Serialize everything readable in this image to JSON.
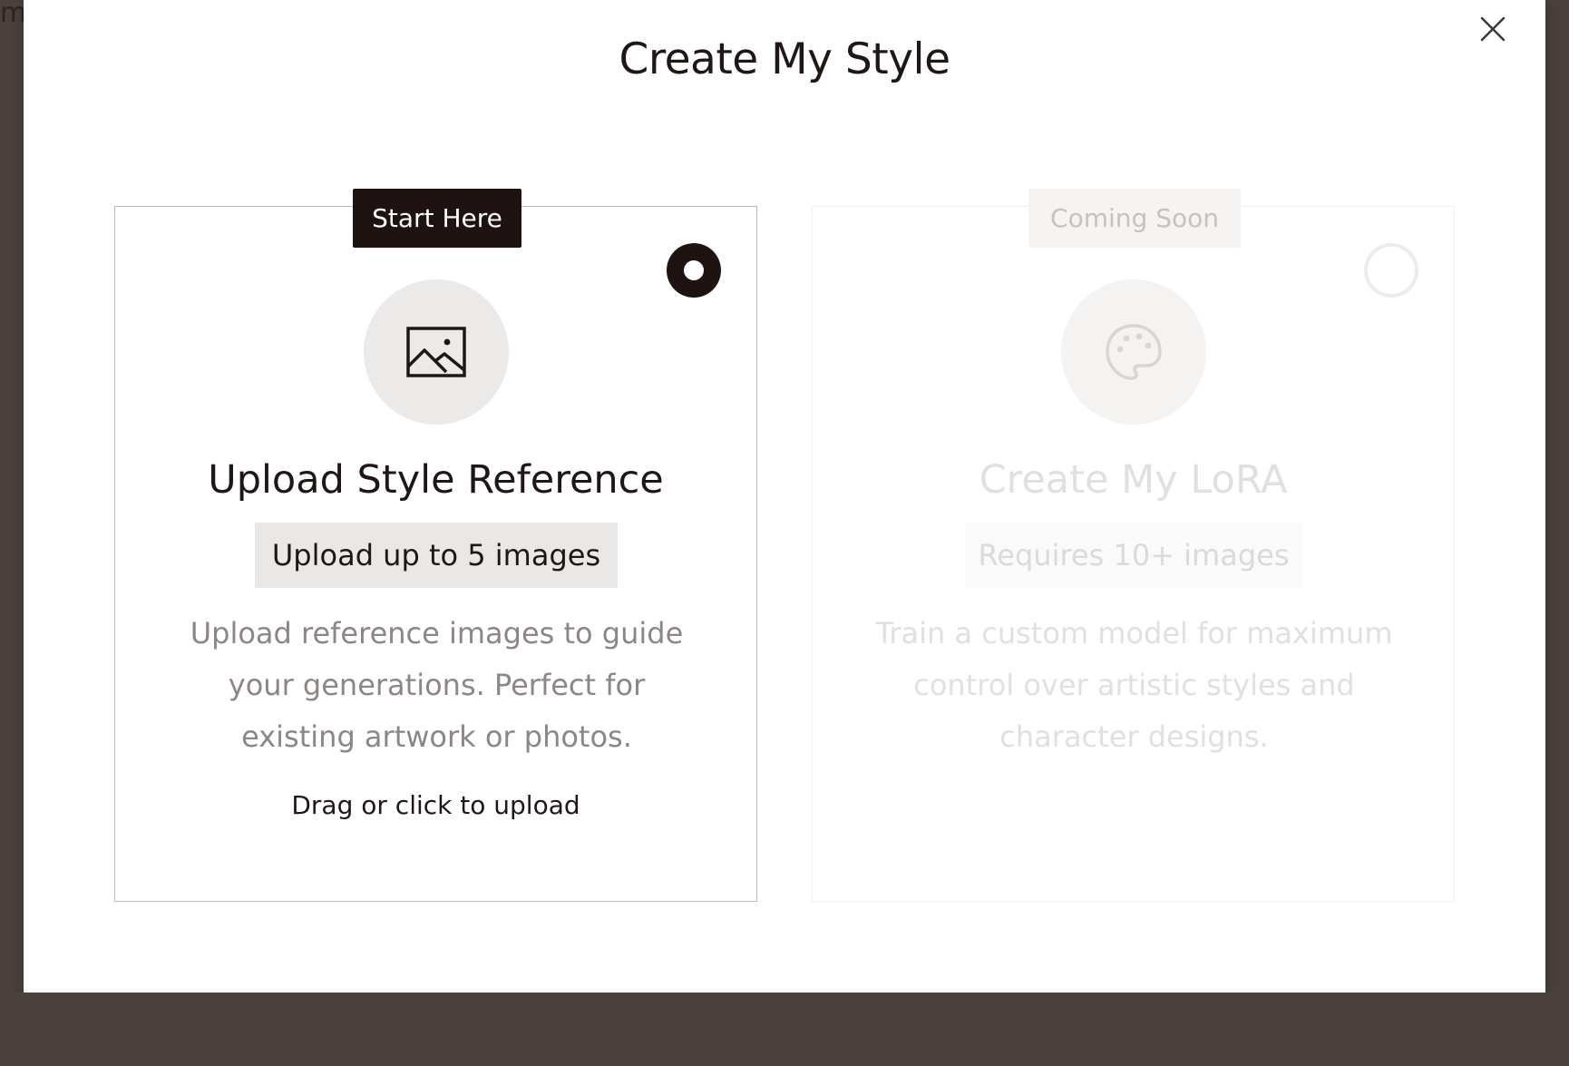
{
  "background": {
    "peek_text": "me"
  },
  "modal": {
    "title": "Create My Style",
    "close_label": "Close"
  },
  "cards": [
    {
      "tag": "Start Here",
      "title": "Upload Style Reference",
      "badge": "Upload up to 5 images",
      "description": "Upload reference images to guide your generations. Perfect for existing artwork or photos.",
      "hint": "Drag or click to upload",
      "selected": true,
      "icon": "image-icon"
    },
    {
      "tag": "Coming Soon",
      "title": "Create My LoRA",
      "badge": "Requires 10+ images",
      "description": "Train a custom model for maximum control over artistic styles and character designs.",
      "selected": false,
      "icon": "palette-icon"
    }
  ],
  "colors": {
    "overlay": "#4a403c",
    "dark": "#1f1312",
    "badge_bg": "#e9e8e7",
    "muted_text": "#8c8684"
  }
}
